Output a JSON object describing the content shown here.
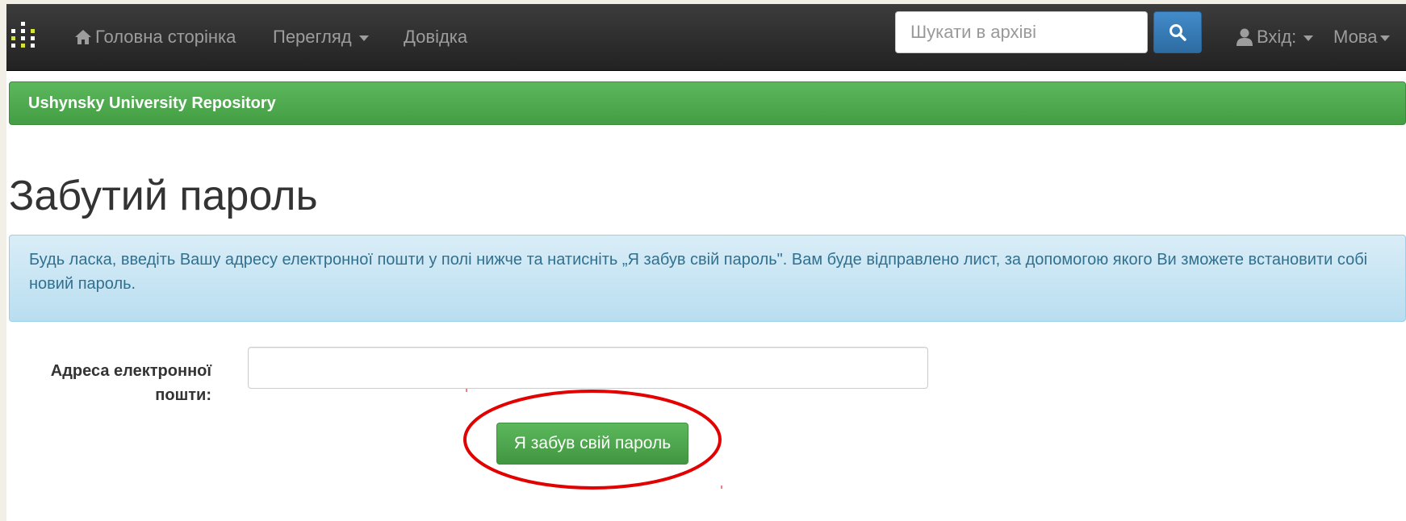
{
  "navbar": {
    "logo": "dspace-logo-icon",
    "home_icon": "home-icon",
    "home_label": "Головна сторінка",
    "browse_label": "Перегляд",
    "help_label": "Довідка",
    "search": {
      "placeholder": "Шукати в архіві",
      "value": "",
      "button_icon": "search-icon"
    },
    "login_icon": "user-icon",
    "login_label": "Вхід:",
    "language_label": "Мова"
  },
  "header": {
    "repository_name": "Ushynsky University Repository",
    "background_color": "#5cb85c"
  },
  "main": {
    "title": "Забутий пароль",
    "info_text": "Будь ласка, введіть Вашу адресу електронної пошти у полі нижче та натисніть „Я забув свій пароль\". Вам буде відправлено лист, за допомогою якого Ви зможете встановити собі новий пароль.",
    "form": {
      "email_label": "Адреса електронної пошти:",
      "email_value": "",
      "submit_label": "Я забув свій пароль"
    }
  },
  "annotation": {
    "shape": "ellipse",
    "target": "submit-button",
    "color": "#e20000"
  },
  "colors": {
    "navbar_bg": "#222222",
    "primary_blue": "#428bca",
    "success_green": "#5cb85c",
    "info_bg": "#d9edf7",
    "info_text": "#31708f"
  }
}
